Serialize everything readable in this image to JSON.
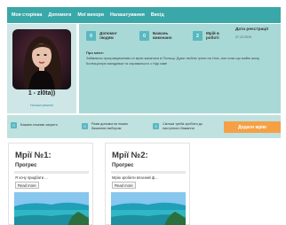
{
  "nav": {
    "items": [
      "Моя сторінка",
      "Допомоги",
      "Мої вихори",
      "Налаштування",
      "Вихід"
    ]
  },
  "profile": {
    "username": "1 - zl0ta))",
    "settings_link": "Налаштування",
    "stats": [
      {
        "num": "0",
        "label1": "Допомог",
        "label2": "людям"
      },
      {
        "num": "0",
        "label1": "Бажань",
        "label2": "виконано"
      },
      {
        "num": "2",
        "label1": "Мрій в",
        "label2": "роботі"
      }
    ],
    "registration": {
      "title1": "Дата реєстрації",
      "date": "27.12.2019"
    },
    "about": {
      "heading": "Про мене:",
      "text1": "Займаюся програмуванням та мрію жакатися в Польщі. Дуже люблю грати на Нозі, але поки що майю жалу.",
      "text2": "Колекціоную мандрівки та справжнього з Ніді хаве"
    }
  },
  "actions": {
    "items": [
      {
        "num": "0",
        "line1": "Бажань іншими закрито",
        "line2": ""
      },
      {
        "num": "0",
        "line1": "Разів допомогли іншим",
        "line2": "бажаннях вибором"
      },
      {
        "num": "3",
        "line1": "Скільки треба зробити до",
        "line2": "наступного бажання"
      }
    ],
    "add_button": "Додати мрію"
  },
  "dreams": [
    {
      "title": "Мрії №1:",
      "progress_label": "Прогрес",
      "progress": 0.0,
      "desc": "Я хочу придбати ...",
      "more": "Read more"
    },
    {
      "title": "Мрії №2:",
      "progress_label": "Прогрес",
      "progress": 0.0,
      "desc": "Мрію зробити власний ф...",
      "more": "Read more"
    }
  ],
  "colors": {
    "nav": "#3aa8a8",
    "accent": "#5ab8c0",
    "button": "#f5a045",
    "panel": "#a9d9d7"
  }
}
